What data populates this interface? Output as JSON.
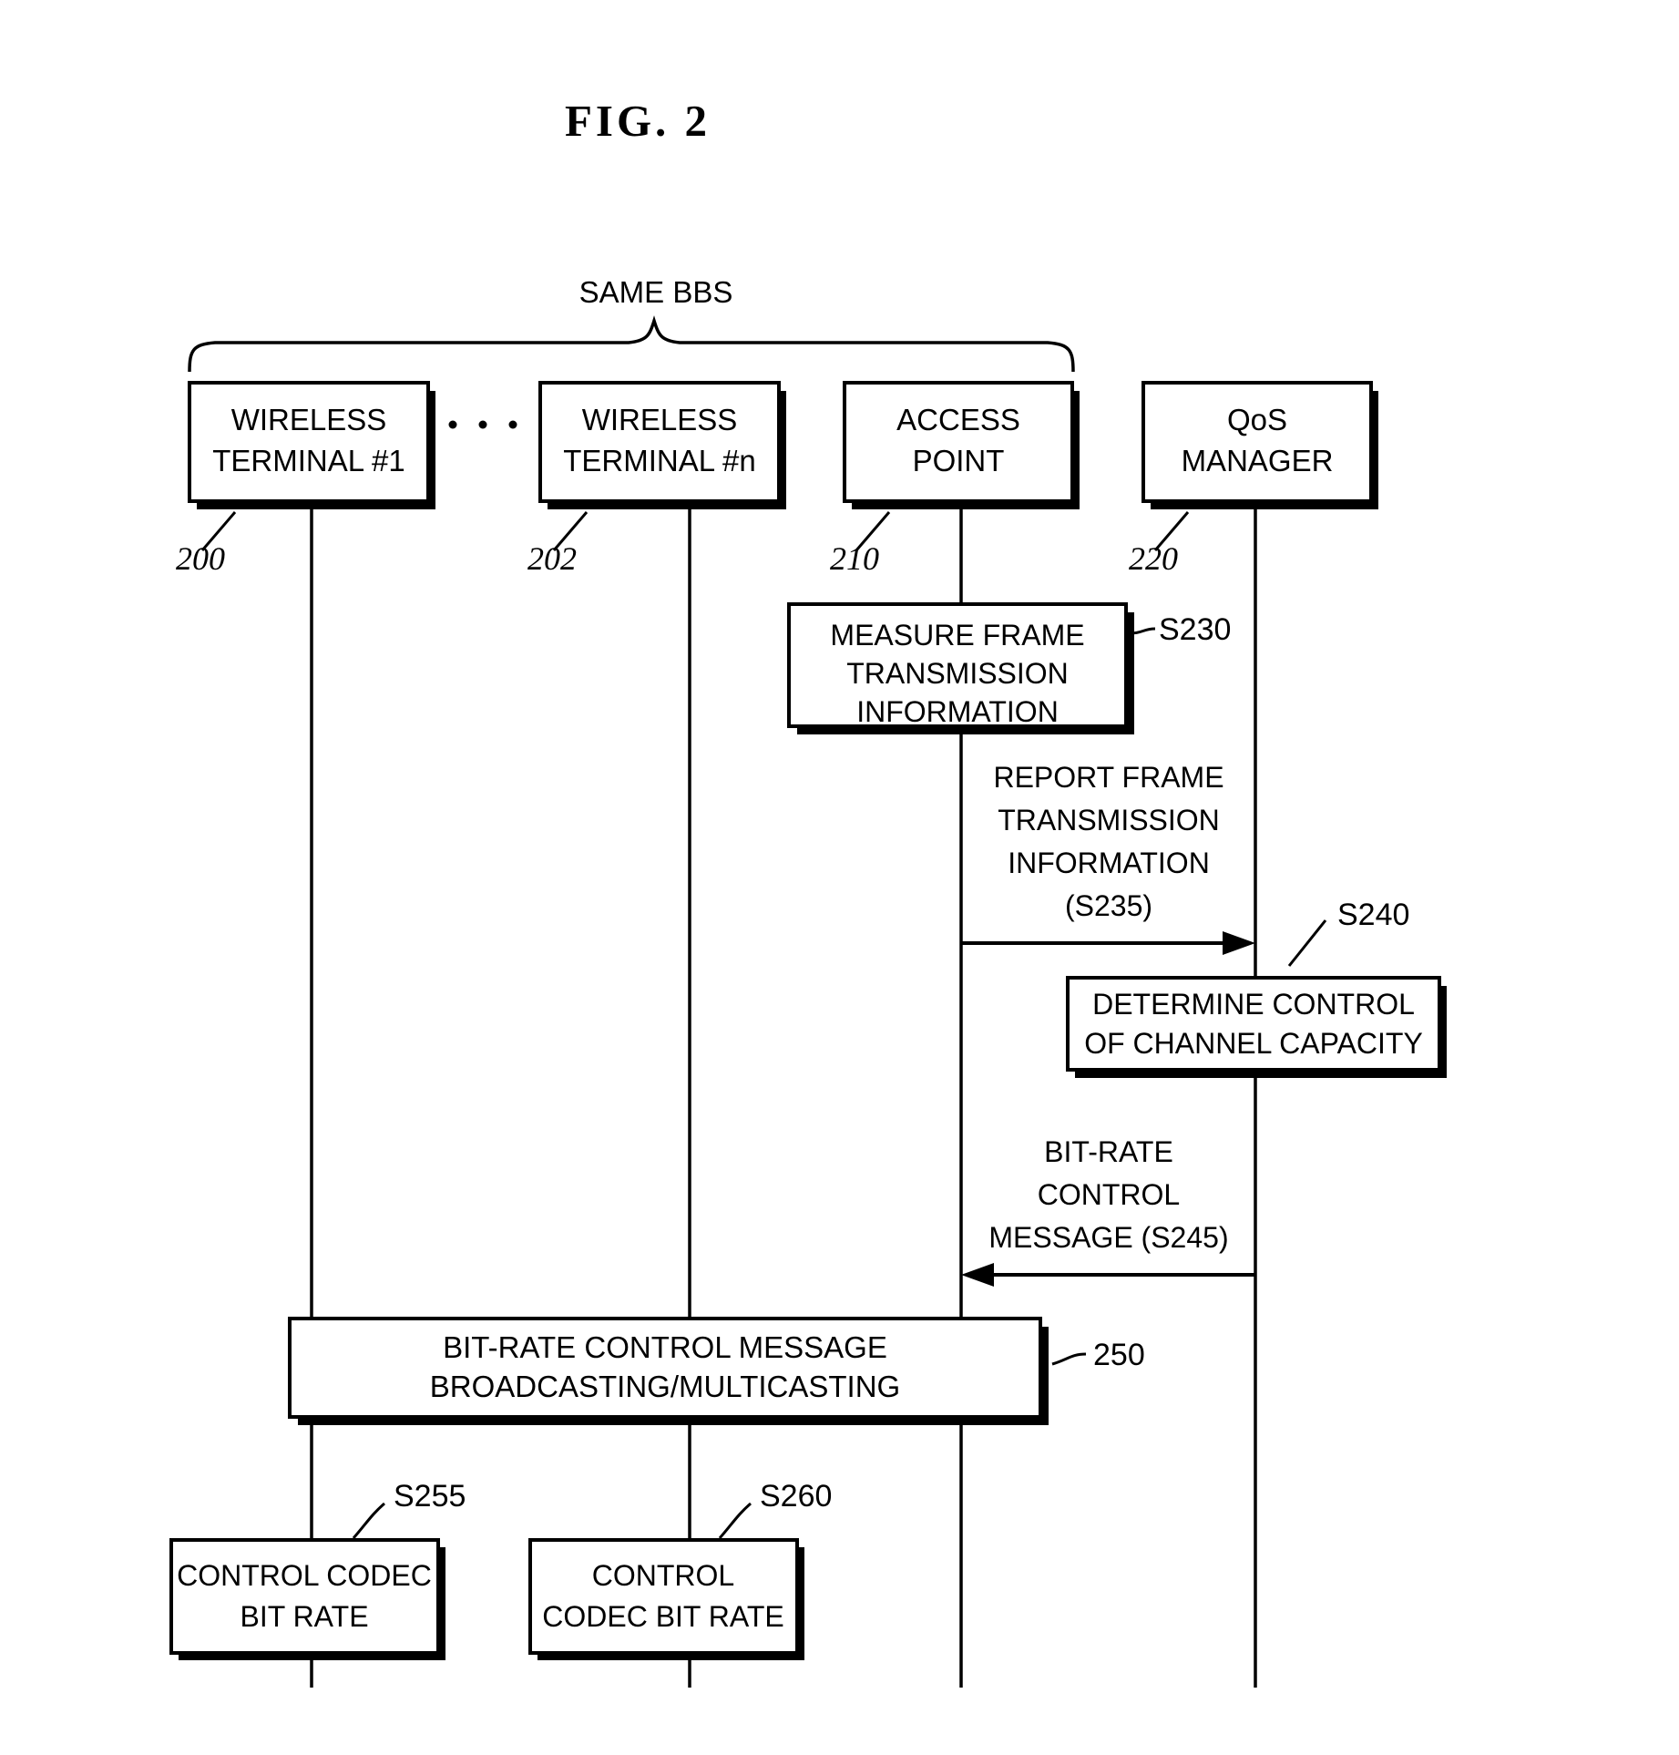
{
  "figure": {
    "title": "FIG.  2",
    "group_label": "SAME BBS"
  },
  "lifelines": [
    {
      "id": "wt1",
      "title_line1": "WIRELESS",
      "title_line2": "TERMINAL #1",
      "ref": "200"
    },
    {
      "id": "wtn",
      "title_line1": "WIRELESS",
      "title_line2": "TERMINAL #n",
      "ref": "202"
    },
    {
      "id": "ap",
      "title_line1": "ACCESS",
      "title_line2": "POINT",
      "ref": "210"
    },
    {
      "id": "qos",
      "title_line1": "QoS",
      "title_line2": "MANAGER",
      "ref": "220"
    }
  ],
  "ellipsis": "· · ·",
  "steps": {
    "s230": {
      "ref": "S230",
      "lines": [
        "MEASURE FRAME",
        "TRANSMISSION",
        "INFORMATION"
      ]
    },
    "s235": {
      "lines": [
        "REPORT FRAME",
        "TRANSMISSION",
        "INFORMATION",
        "(S235)"
      ]
    },
    "s240": {
      "ref": "S240",
      "lines": [
        "DETERMINE CONTROL",
        "OF CHANNEL CAPACITY"
      ]
    },
    "s245": {
      "lines": [
        "BIT-RATE",
        "CONTROL",
        "MESSAGE (S245)"
      ]
    },
    "s250": {
      "ref": "250",
      "lines": [
        "BIT-RATE CONTROL MESSAGE",
        "BROADCASTING/MULTICASTING"
      ]
    },
    "s255": {
      "ref": "S255",
      "lines": [
        "CONTROL CODEC",
        "BIT RATE"
      ]
    },
    "s260": {
      "ref": "S260",
      "lines": [
        "CONTROL",
        "CODEC BIT RATE"
      ]
    }
  },
  "colors": {
    "ink": "#000000",
    "paper": "#ffffff"
  }
}
